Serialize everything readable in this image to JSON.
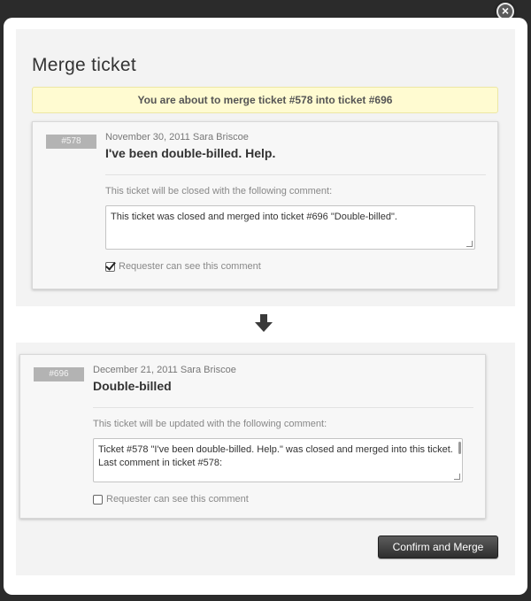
{
  "dialog": {
    "title": "Merge ticket",
    "close_label": "×",
    "notice": "You are about to merge ticket #578 into ticket #696"
  },
  "source_ticket": {
    "id_badge": "#578",
    "meta": "November 30, 2011 Sara Briscoe",
    "subject": "I've been double-billed. Help.",
    "comment_label": "This ticket will be closed with the following comment:",
    "comment_value": "This ticket was closed and merged into ticket #696 \"Double-billed\".",
    "requester_visible_label": "Requester can see this comment",
    "requester_visible_checked": true
  },
  "target_ticket": {
    "id_badge": "#696",
    "meta": "December 21, 2011 Sara Briscoe",
    "subject": "Double-billed",
    "comment_label": "This ticket will be updated with the following comment:",
    "comment_value_line1": "Ticket #578 \"I've been double-billed. Help.\" was closed and merged into this ticket. Last comment in ticket #578:",
    "requester_visible_label": "Requester can see this comment",
    "requester_visible_checked": false
  },
  "actions": {
    "confirm_label": "Confirm and Merge"
  },
  "colors": {
    "notice_bg": "#fffbd1",
    "badge_bg": "#b3b3b3",
    "button_bg": "#3a3a3a"
  },
  "icons": {
    "close": "close-icon",
    "arrow": "arrow-down-icon",
    "check": "checkmark-icon"
  }
}
